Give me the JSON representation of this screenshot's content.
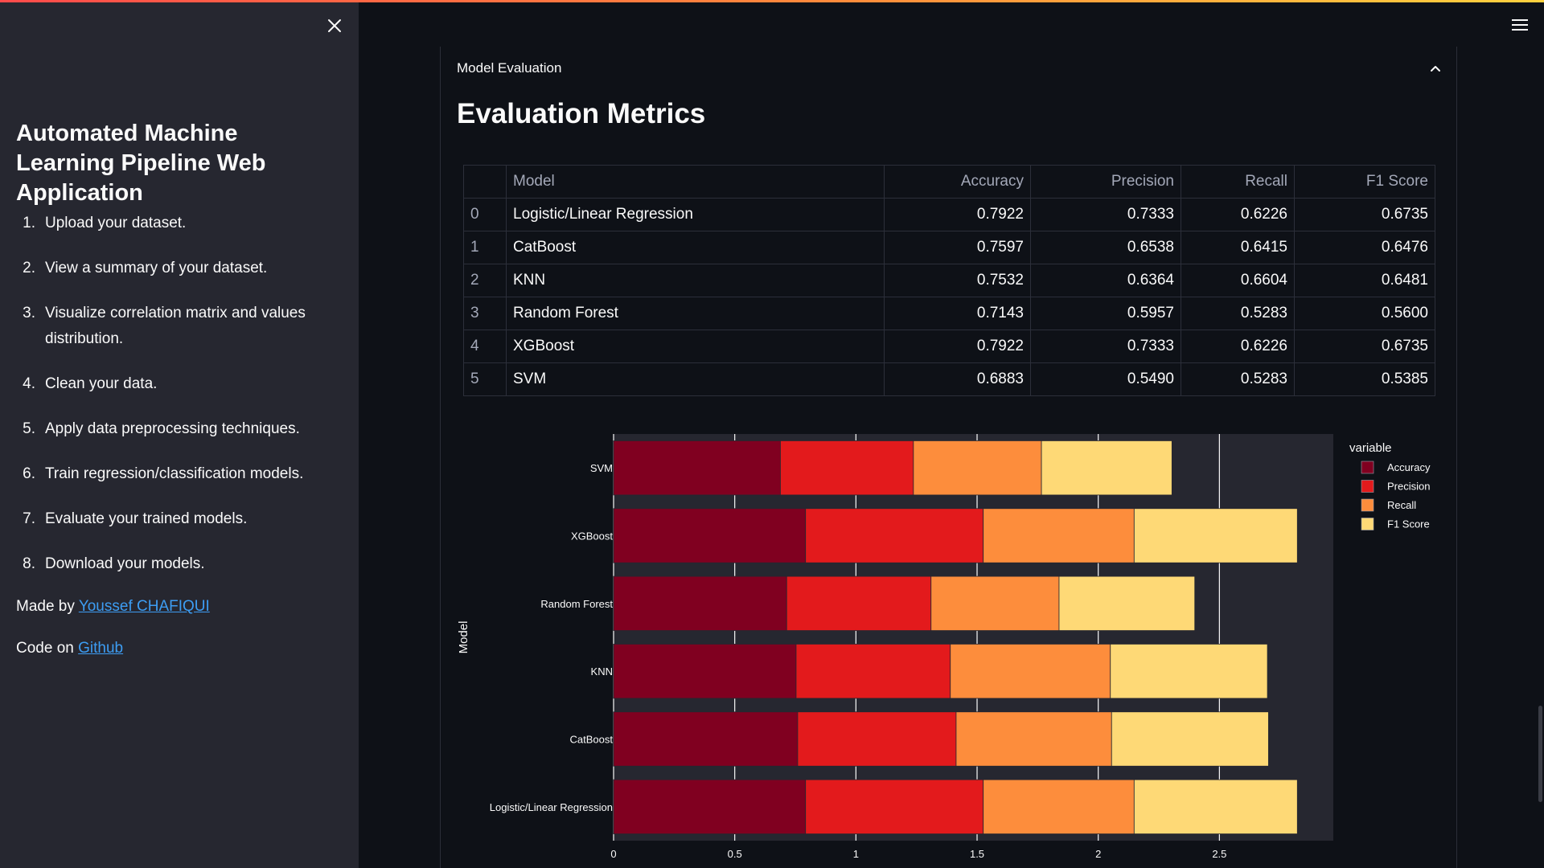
{
  "sidebar": {
    "title": "Automated Machine Learning Pipeline Web Application",
    "steps": [
      {
        "num": "1.",
        "text": "Upload your dataset."
      },
      {
        "num": "2.",
        "text": "View a summary of your dataset."
      },
      {
        "num": "3.",
        "text": "Visualize correlation matrix and values distribution."
      },
      {
        "num": "4.",
        "text": "Clean your data."
      },
      {
        "num": "5.",
        "text": "Apply data preprocessing techniques."
      },
      {
        "num": "6.",
        "text": "Train regression/classification models."
      },
      {
        "num": "7.",
        "text": "Evaluate your trained models."
      },
      {
        "num": "8.",
        "text": "Download your models."
      }
    ],
    "made_by_prefix": "Made by ",
    "made_by_link": "Youssef CHAFIQUI",
    "code_prefix": "Code on ",
    "code_link": "Github"
  },
  "expander": {
    "title": "Model Evaluation"
  },
  "main": {
    "title": "Evaluation Metrics"
  },
  "table": {
    "headers": [
      "",
      "Model",
      "Accuracy",
      "Precision",
      "Recall",
      "F1 Score"
    ],
    "rows": [
      {
        "index": "0",
        "model": "Logistic/Linear Regression",
        "accuracy": "0.7922",
        "precision": "0.7333",
        "recall": "0.6226",
        "f1": "0.6735"
      },
      {
        "index": "1",
        "model": "CatBoost",
        "accuracy": "0.7597",
        "precision": "0.6538",
        "recall": "0.6415",
        "f1": "0.6476"
      },
      {
        "index": "2",
        "model": "KNN",
        "accuracy": "0.7532",
        "precision": "0.6364",
        "recall": "0.6604",
        "f1": "0.6481"
      },
      {
        "index": "3",
        "model": "Random Forest",
        "accuracy": "0.7143",
        "precision": "0.5957",
        "recall": "0.5283",
        "f1": "0.5600"
      },
      {
        "index": "4",
        "model": "XGBoost",
        "accuracy": "0.7922",
        "precision": "0.7333",
        "recall": "0.6226",
        "f1": "0.6735"
      },
      {
        "index": "5",
        "model": "SVM",
        "accuracy": "0.6883",
        "precision": "0.5490",
        "recall": "0.5283",
        "f1": "0.5385"
      }
    ]
  },
  "chart_data": {
    "type": "bar",
    "orientation": "horizontal",
    "stacked": true,
    "categories": [
      "Logistic/Linear Regression",
      "CatBoost",
      "KNN",
      "Random Forest",
      "XGBoost",
      "SVM"
    ],
    "series": [
      {
        "name": "Accuracy",
        "color": "#800020",
        "values": [
          0.7922,
          0.7597,
          0.7532,
          0.7143,
          0.7922,
          0.6883
        ]
      },
      {
        "name": "Precision",
        "color": "#e31a1c",
        "values": [
          0.7333,
          0.6538,
          0.6364,
          0.5957,
          0.7333,
          0.549
        ]
      },
      {
        "name": "Recall",
        "color": "#fd8d3c",
        "values": [
          0.6226,
          0.6415,
          0.6604,
          0.5283,
          0.6226,
          0.5283
        ]
      },
      {
        "name": "F1 Score",
        "color": "#fed976",
        "values": [
          0.6735,
          0.6476,
          0.6481,
          0.56,
          0.6735,
          0.5385
        ]
      }
    ],
    "xticks": [
      0,
      0.5,
      1,
      1.5,
      2,
      2.5
    ],
    "xtick_labels": [
      "0",
      "0.5",
      "1",
      "1.5",
      "2",
      "2.5"
    ],
    "xlim": [
      0,
      2.97
    ],
    "ylabel": "Model",
    "legend_title": "variable",
    "legend_position": "top-right",
    "grid": true
  }
}
